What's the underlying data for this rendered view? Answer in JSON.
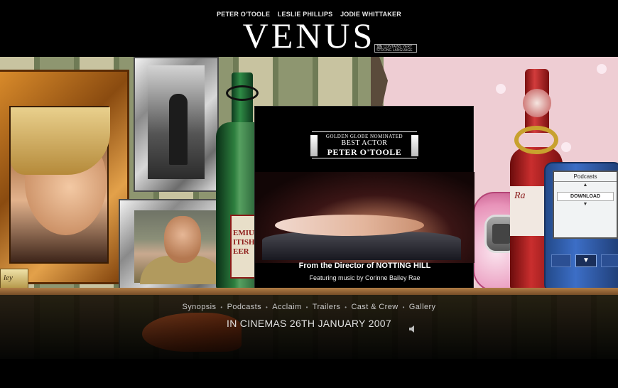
{
  "header": {
    "cast": [
      "PETER O'TOOLE",
      "LESLIE PHILLIPS",
      "JODIE WHITTAKER"
    ],
    "title": "VENUS",
    "rating": {
      "age": "15",
      "text": "CONTAINS VERY STRONG LANGUAGE"
    }
  },
  "scene": {
    "plaque_text": "ley",
    "beer_label": "EMIUM ITISH EER",
    "bottle_label": "Ra",
    "player": {
      "title": "Podcasts",
      "download_label": "DOWNLOAD",
      "up": "▲",
      "down": "▼",
      "button": "▼"
    }
  },
  "poster": {
    "award_line1": "GOLDEN GLOBE NOMINATED",
    "award_line2": "BEST ACTOR",
    "award_line3": "PETER O'TOOLE",
    "director": "From the Director of NOTTING HILL",
    "music": "Featuring music by Corinne Bailey Rae"
  },
  "nav": {
    "items": [
      "Synopsis",
      "Podcasts",
      "Acclaim",
      "Trailers",
      "Cast & Crew",
      "Gallery"
    ],
    "separator": "•"
  },
  "release": "IN CINEMAS 26TH JANUARY 2007",
  "sound_icon": "speaker-icon",
  "colors": {
    "background": "#000000",
    "accent_gold": "#c8a12e",
    "nav_text": "#c9c9c9"
  }
}
